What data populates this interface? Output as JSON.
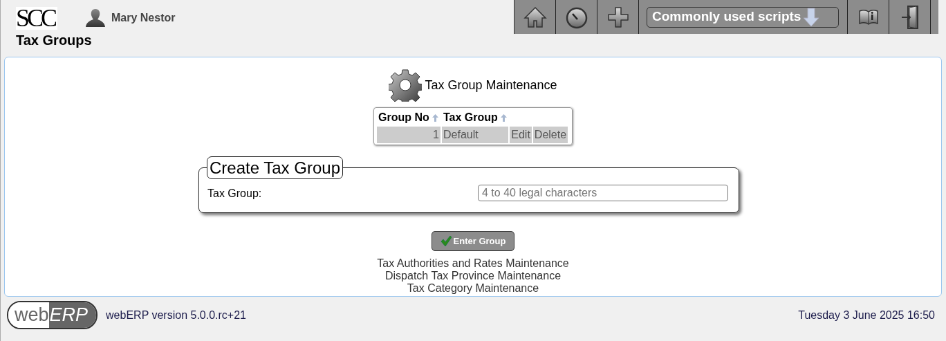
{
  "header": {
    "logo": "SCC",
    "user": "Mary Nestor",
    "page_title": "Tax Groups",
    "scripts_menu": "Commonly used scripts"
  },
  "main": {
    "title": "Tax Group Maintenance",
    "table": {
      "columns": [
        "Group No",
        "Tax Group"
      ],
      "rows": [
        {
          "group_no": "1",
          "tax_group": "Default",
          "actions": [
            "Edit",
            "Delete"
          ]
        }
      ]
    },
    "form": {
      "legend": "Create Tax Group",
      "label": "Tax Group:",
      "placeholder": "4 to 40 legal characters"
    },
    "button": "Enter Group",
    "links": [
      "Tax Authorities and Rates Maintenance",
      "Dispatch Tax Province Maintenance",
      "Tax Category Maintenance"
    ]
  },
  "footer": {
    "logo_left": "web",
    "logo_right": "ERP",
    "version": "webERP version 5.0.0.rc+21",
    "datetime": "Tuesday 3 June 2025 16:50"
  }
}
